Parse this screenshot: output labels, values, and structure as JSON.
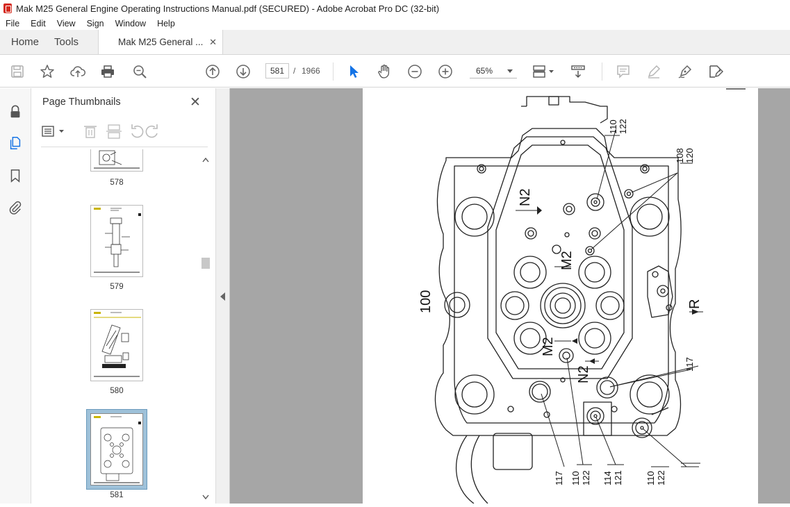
{
  "window": {
    "title": "Mak M25 General Engine Operating Instructions Manual.pdf (SECURED) - Adobe Acrobat Pro DC (32-bit)"
  },
  "menu": [
    "File",
    "Edit",
    "View",
    "Sign",
    "Window",
    "Help"
  ],
  "tabs": {
    "home": "Home",
    "tools": "Tools",
    "document": "Mak M25 General ...",
    "close_glyph": "✕"
  },
  "toolbar": {
    "current_page": "581",
    "page_separator": "/",
    "total_pages": "1966",
    "zoom": "65%"
  },
  "panel": {
    "title": "Page Thumbnails",
    "close_glyph": "✕",
    "thumbnails": [
      {
        "label": "578",
        "selected": false
      },
      {
        "label": "579",
        "selected": false
      },
      {
        "label": "580",
        "selected": false
      },
      {
        "label": "581",
        "selected": true
      }
    ]
  },
  "drawing": {
    "labels": {
      "n2_top": "N2",
      "m2_top": "M2",
      "m2_bottom": "M2",
      "n2_bottom": "N2",
      "l100": "100",
      "r": "R",
      "l110_top": "110",
      "l122_top": "122",
      "l108": "108",
      "l120": "120",
      "l117_right": "117",
      "l117_bottom": "117",
      "l110_b1": "110",
      "l122_b1": "122",
      "l114": "114",
      "l121": "121",
      "l110_b2": "110",
      "l122_b2": "122"
    }
  }
}
